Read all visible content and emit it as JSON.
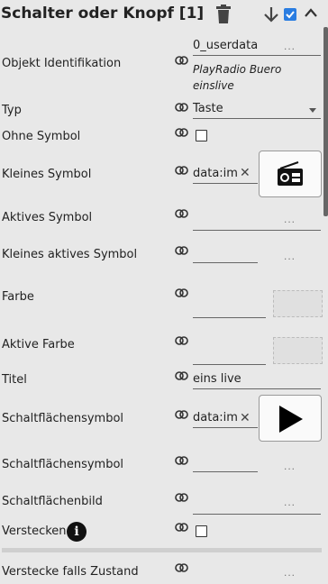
{
  "header": {
    "title": "Schalter oder Knopf [1]"
  },
  "rows": {
    "objekt": {
      "label": "Objekt Identifikation",
      "value": "0_userdata",
      "desc1": "PlayRadio Buero",
      "desc2": "einslive"
    },
    "typ": {
      "label": "Typ",
      "value": "Taste"
    },
    "ohne_symbol": {
      "label": "Ohne Symbol"
    },
    "kleines_symbol": {
      "label": "Kleines Symbol",
      "value": "data:im"
    },
    "aktives_symbol": {
      "label": "Aktives Symbol"
    },
    "kleines_aktives": {
      "label": "Kleines aktives Symbol"
    },
    "farbe": {
      "label": "Farbe"
    },
    "aktive_farbe": {
      "label": "Aktive Farbe"
    },
    "titel": {
      "label": "Titel",
      "value": "eins live"
    },
    "schaltflaechensymbol": {
      "label": "Schaltflächensymbol",
      "value": "data:im"
    },
    "schaltflaechensymbol2": {
      "label": "Schaltflächensymbol"
    },
    "schaltflaechenbild": {
      "label": "Schaltflächenbild"
    },
    "verstecken": {
      "label": "Verstecken"
    },
    "verstecke_zustand": {
      "label": "Verstecke falls Zustand"
    }
  },
  "glyphs": {
    "dots": "...",
    "clear": "✕",
    "info": "i"
  }
}
